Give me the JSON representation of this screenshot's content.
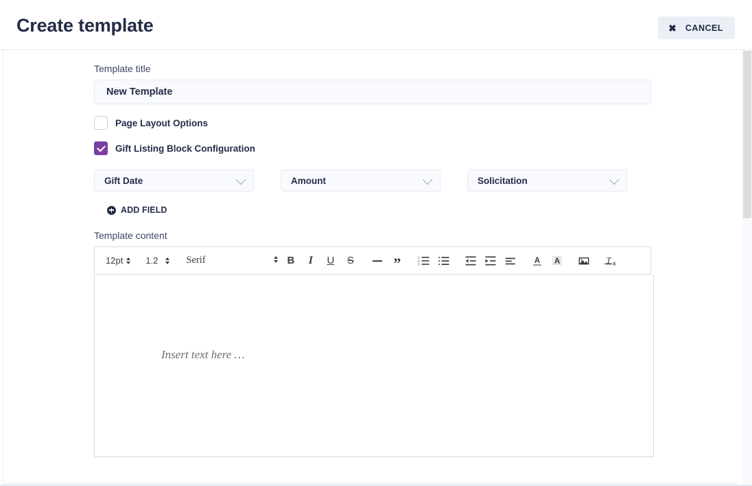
{
  "header": {
    "title": "Create template",
    "cancel_label": "CANCEL",
    "cancel_icon": "close-icon",
    "title_color": "#242c48",
    "cancel_bg": "#eaeef5"
  },
  "form": {
    "template_title": {
      "label": "Template title",
      "value": "New Template",
      "placeholder": "New Template"
    },
    "checkboxes": [
      {
        "label": "Page Layout Options",
        "checked": false
      },
      {
        "label": "Gift Listing Block Configuration",
        "checked": true
      }
    ],
    "checked_color": "#7a3fa3",
    "gift_fields": [
      {
        "value": "Gift Date",
        "icon": "chevron-down-icon"
      },
      {
        "value": "Amount",
        "icon": "chevron-down-icon"
      },
      {
        "value": "Solicitation",
        "icon": "chevron-down-icon"
      }
    ],
    "add_field": {
      "label": "ADD FIELD",
      "icon": "plus-circle-icon"
    },
    "template_content": {
      "label": "Template content",
      "placeholder": "Insert text here …"
    }
  },
  "editor_toolbar": {
    "font_size": {
      "value": "12pt",
      "icon": "stepper-updown-icon"
    },
    "line_height": {
      "value": "1.2",
      "icon": "stepper-updown-icon"
    },
    "font_family": {
      "value": "Serif",
      "icon": "stepper-updown-icon"
    },
    "buttons": [
      {
        "name": "bold-icon",
        "glyph": "B",
        "style": "b-ico"
      },
      {
        "name": "italic-icon",
        "glyph": "I",
        "style": "i-ico"
      },
      {
        "name": "underline-icon",
        "glyph": "U",
        "style": "u-ico"
      },
      {
        "name": "strikethrough-icon",
        "glyph": "S",
        "style": "s-ico"
      },
      {
        "name": "horizontal-rule-icon",
        "glyph": "—",
        "style": "hr-ico"
      },
      {
        "name": "blockquote-icon",
        "glyph": "”",
        "style": "q-ico"
      },
      {
        "name": "numbered-list-icon",
        "glyph": "",
        "style": "svg"
      },
      {
        "name": "bullet-list-icon",
        "glyph": "",
        "style": "svg"
      },
      {
        "name": "outdent-icon",
        "glyph": "",
        "style": "svg"
      },
      {
        "name": "indent-icon",
        "glyph": "",
        "style": "svg"
      },
      {
        "name": "align-left-icon",
        "glyph": "",
        "style": "svg"
      },
      {
        "name": "text-color-icon",
        "glyph": "A",
        "style": "svg"
      },
      {
        "name": "highlight-color-icon",
        "glyph": "A",
        "style": "svg"
      },
      {
        "name": "insert-image-icon",
        "glyph": "",
        "style": "svg"
      },
      {
        "name": "clear-formatting-icon",
        "glyph": "Tx",
        "style": "svg"
      }
    ]
  },
  "scrollbar": {
    "name": "vertical-scrollbar",
    "thumb_color": "#dcdcdc"
  }
}
